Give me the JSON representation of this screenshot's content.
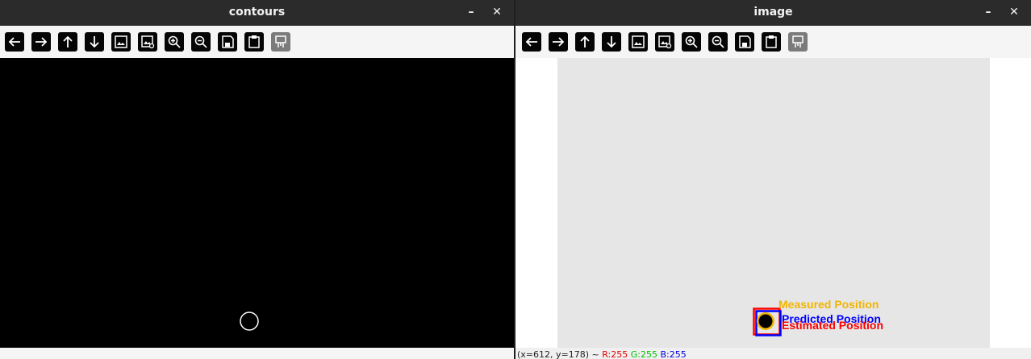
{
  "windows": {
    "left": {
      "title": "contours",
      "minimize_glyph": "–",
      "close_glyph": "✕"
    },
    "right": {
      "title": "image",
      "minimize_glyph": "–",
      "close_glyph": "✕",
      "overlay": {
        "measured_label": "Measured Position",
        "predicted_label": "Predicted Position",
        "estimated_label": "Estimated Position",
        "colors": {
          "measured": "#f2b500",
          "predicted": "#0000ff",
          "estimated": "#ff0000",
          "object": "#000000"
        }
      },
      "status": {
        "coords": "(x=612, y=178) ~",
        "r": "R:255",
        "g": "G:255",
        "b": "B:255"
      }
    }
  },
  "toolbar_icons": [
    "arrow-left-icon",
    "arrow-right-icon",
    "arrow-up-icon",
    "arrow-down-icon",
    "image-icon",
    "image-settings-icon",
    "zoom-in-icon",
    "zoom-out-icon",
    "save-icon",
    "clipboard-icon",
    "properties-icon"
  ]
}
